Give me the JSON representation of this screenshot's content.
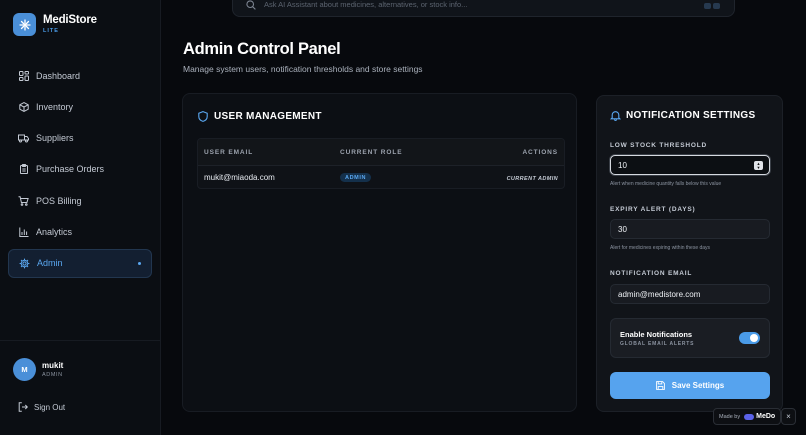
{
  "brand": {
    "name": "MediStore",
    "tag": "LITE"
  },
  "nav": [
    {
      "label": "Dashboard",
      "icon": "grid-icon"
    },
    {
      "label": "Inventory",
      "icon": "box-icon"
    },
    {
      "label": "Suppliers",
      "icon": "truck-icon"
    },
    {
      "label": "Purchase Orders",
      "icon": "clipboard-icon"
    },
    {
      "label": "POS Billing",
      "icon": "cart-icon"
    },
    {
      "label": "Analytics",
      "icon": "bar-chart-icon"
    },
    {
      "label": "Admin",
      "icon": "gear-icon",
      "active": true
    }
  ],
  "user": {
    "initial": "M",
    "name": "mukit",
    "role": "ADMIN"
  },
  "signout": {
    "label": "Sign Out"
  },
  "search": {
    "placeholder": "Ask AI Assistant about medicines, alternatives, or stock info..."
  },
  "header": {
    "title": "Admin Control Panel",
    "subtitle": "Manage system users, notification thresholds and store settings"
  },
  "user_management": {
    "title": "USER MANAGEMENT",
    "columns": [
      "USER EMAIL",
      "CURRENT ROLE",
      "ACTIONS"
    ],
    "rows": [
      {
        "email": "mukit@miaoda.com",
        "role": "ADMIN",
        "action": "CURRENT ADMIN"
      }
    ]
  },
  "notification_settings": {
    "title": "NOTIFICATION SETTINGS",
    "low_stock": {
      "label": "LOW STOCK THRESHOLD",
      "value": "10",
      "hint": "Alert when medicine quantity falls below this value"
    },
    "expiry": {
      "label": "EXPIRY ALERT (DAYS)",
      "value": "30",
      "hint": "Alert for medicines expiring within these days"
    },
    "email": {
      "label": "NOTIFICATION EMAIL",
      "value": "admin@medistore.com"
    },
    "toggle": {
      "title": "Enable Notifications",
      "subtitle": "GLOBAL EMAIL ALERTS",
      "enabled": true
    },
    "save_label": "Save Settings"
  },
  "made_by": {
    "prefix": "Made by",
    "brand": "MeDo",
    "close": "×"
  },
  "colors": {
    "accent": "#56a3ee",
    "background": "#07090d",
    "sidebar": "#0b0e13",
    "card": "#0c0f14"
  }
}
